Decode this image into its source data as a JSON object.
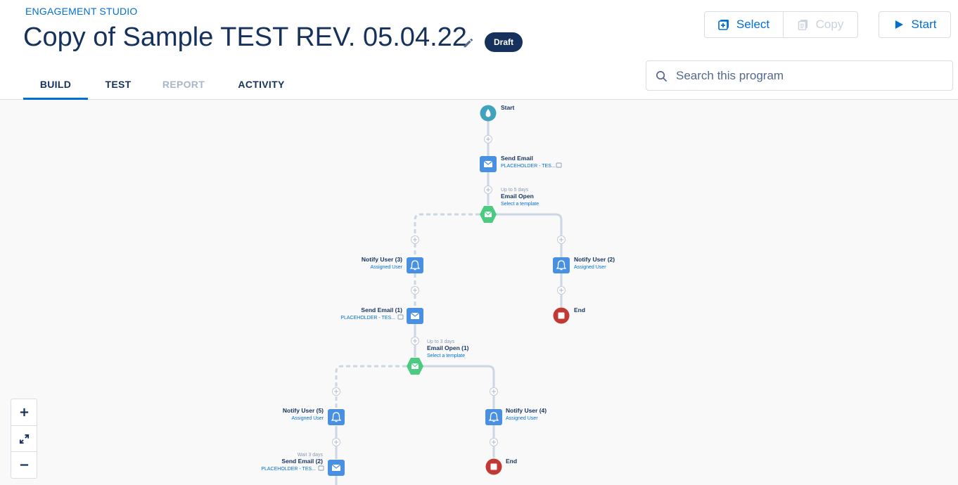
{
  "app": {
    "name": "ENGAGEMENT STUDIO"
  },
  "program": {
    "title": "Copy of Sample TEST REV. 05.04.22",
    "status": "Draft"
  },
  "actions": {
    "select": "Select",
    "copy": "Copy",
    "start": "Start"
  },
  "search": {
    "placeholder": "Search this program"
  },
  "tabs": [
    {
      "label": "BUILD"
    },
    {
      "label": "TEST"
    },
    {
      "label": "REPORT"
    },
    {
      "label": "ACTIVITY"
    }
  ],
  "flow": {
    "start": "Start",
    "send_email": {
      "title": "Send Email",
      "sub": "PLACEHOLDER - TES..."
    },
    "email_open": {
      "wait": "Up to 5 days",
      "title": "Email Open",
      "sub": "Select a template"
    },
    "notify_3": {
      "title": "Notify User (3)",
      "sub": "Assigned User"
    },
    "notify_2": {
      "title": "Notify User (2)",
      "sub": "Assigned User"
    },
    "end_1": "End",
    "send_email_1": {
      "title": "Send Email (1)",
      "sub": "PLACEHOLDER - TES..."
    },
    "email_open_1": {
      "wait": "Up to 3 days",
      "title": "Email Open (1)",
      "sub": "Select a template"
    },
    "notify_5": {
      "title": "Notify User (5)",
      "sub": "Assigned User"
    },
    "notify_4": {
      "title": "Notify User (4)",
      "sub": "Assigned User"
    },
    "send_email_2": {
      "wait": "Wait 3 days",
      "title": "Send Email (2)",
      "sub": "PLACEHOLDER - TES..."
    },
    "end_2": "End"
  },
  "colors": {
    "accent": "#0070d2",
    "navy": "#16325c",
    "trigger": "#4bca81",
    "start": "#41a2bc",
    "end": "#c23934",
    "action": "#4a90e2"
  }
}
